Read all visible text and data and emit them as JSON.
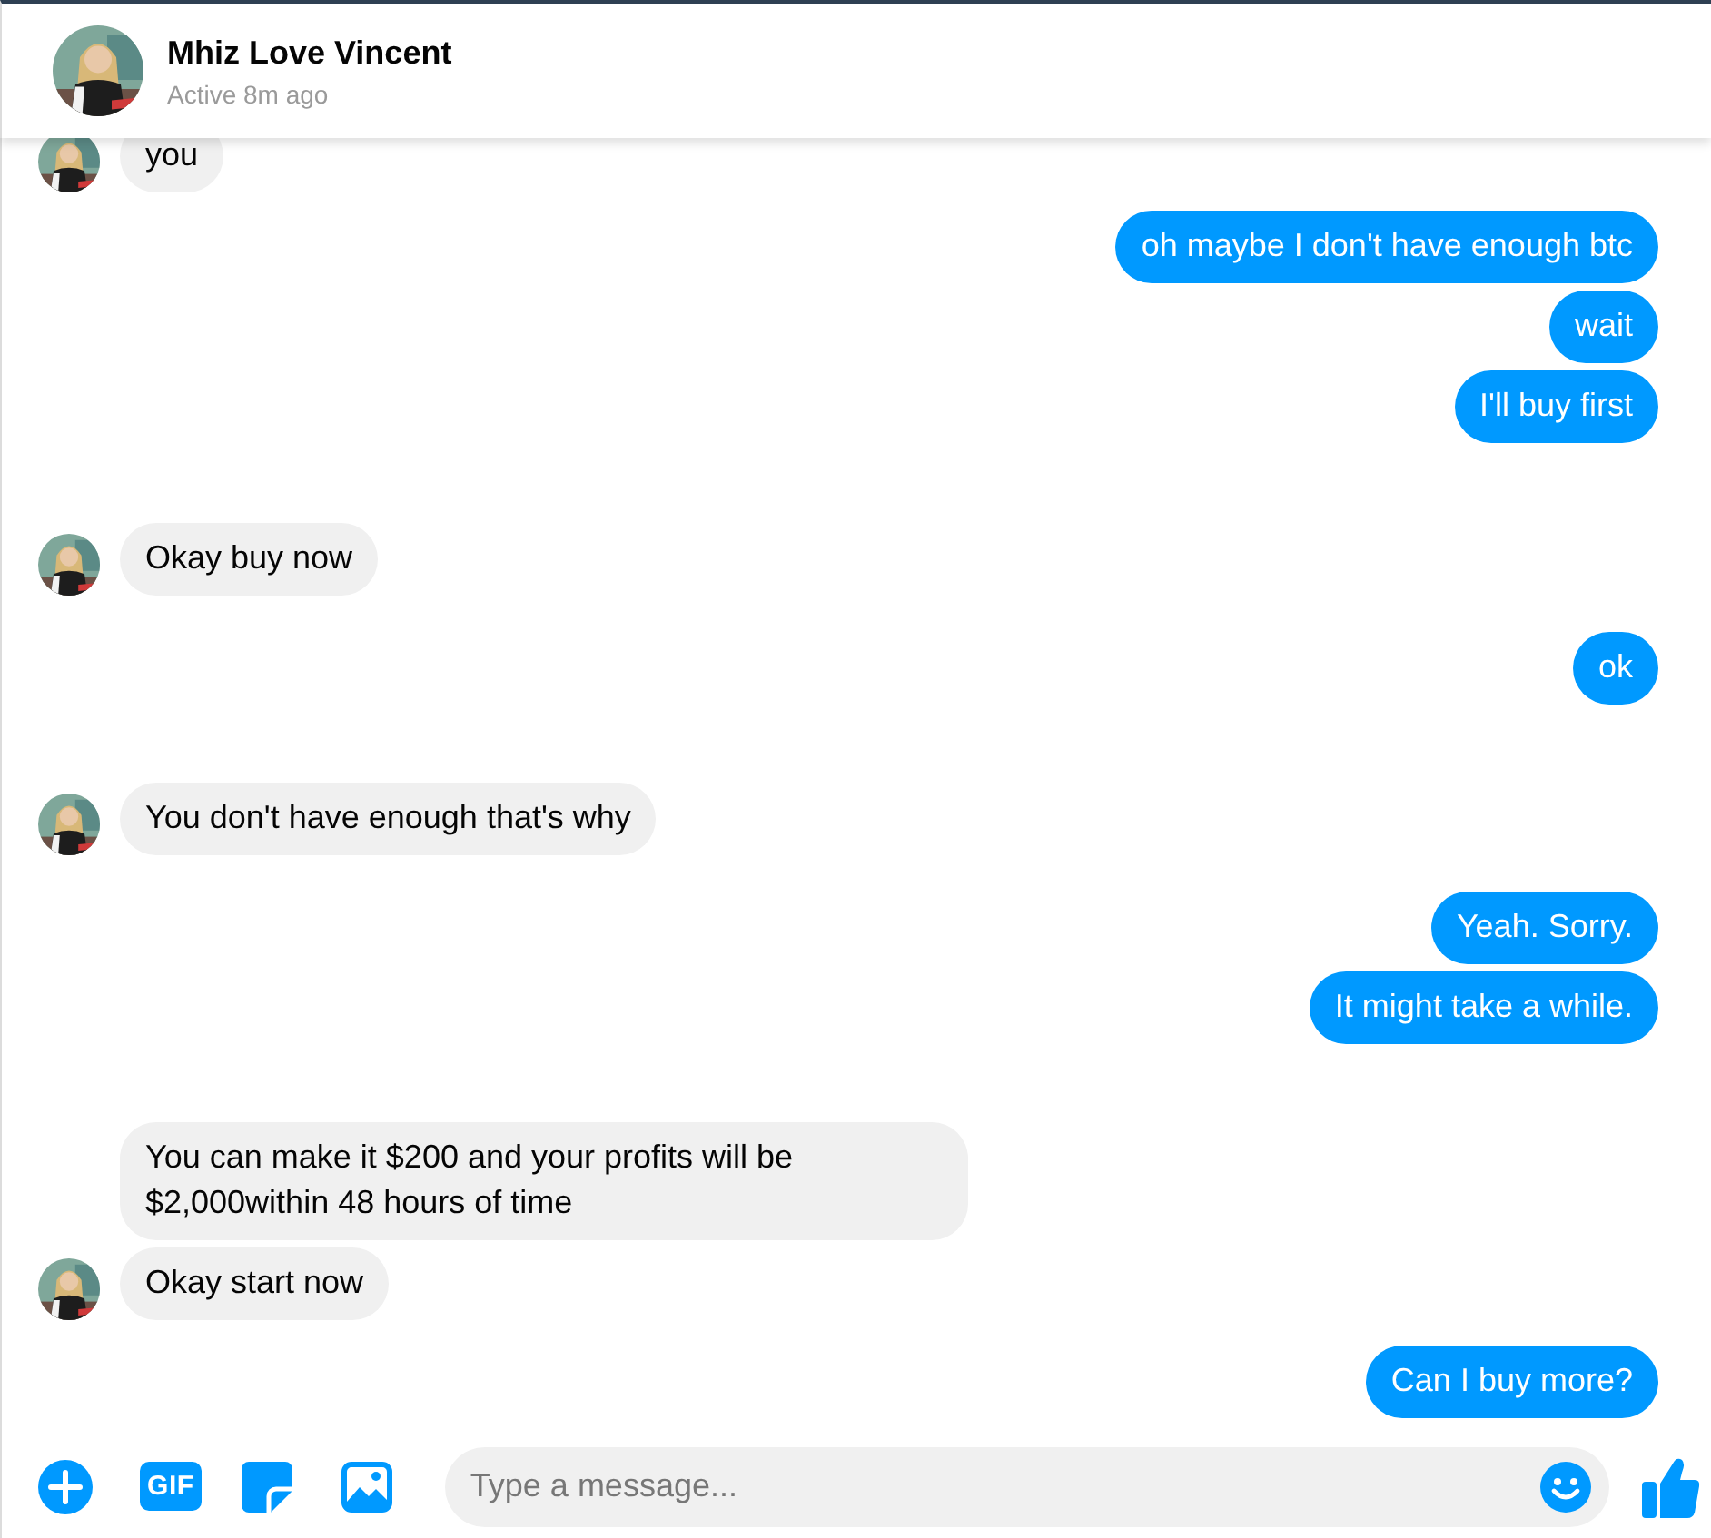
{
  "contact": {
    "name": "Mhiz Love Vincent",
    "status": "Active 8m ago"
  },
  "groups": [
    {
      "kind": "incoming",
      "texts": [
        "you"
      ]
    },
    {
      "kind": "outgoing",
      "texts": [
        "oh maybe I don't have enough btc",
        "wait",
        "I'll buy first"
      ]
    },
    {
      "kind": "incoming",
      "texts": [
        "Okay buy now"
      ]
    },
    {
      "kind": "outgoing",
      "texts": [
        "ok"
      ]
    },
    {
      "kind": "incoming",
      "texts": [
        "You don't have enough that's why"
      ]
    },
    {
      "kind": "outgoing",
      "texts": [
        "Yeah. Sorry.",
        "It might take a while."
      ]
    },
    {
      "kind": "incoming",
      "texts": [
        "You can make it $200 and your profits will be $2,000within 48 hours of time",
        "Okay start now"
      ]
    },
    {
      "kind": "outgoing",
      "texts": [
        "Can I buy more?"
      ]
    }
  ],
  "composer": {
    "gif_label": "GIF",
    "placeholder": "Type a message..."
  }
}
